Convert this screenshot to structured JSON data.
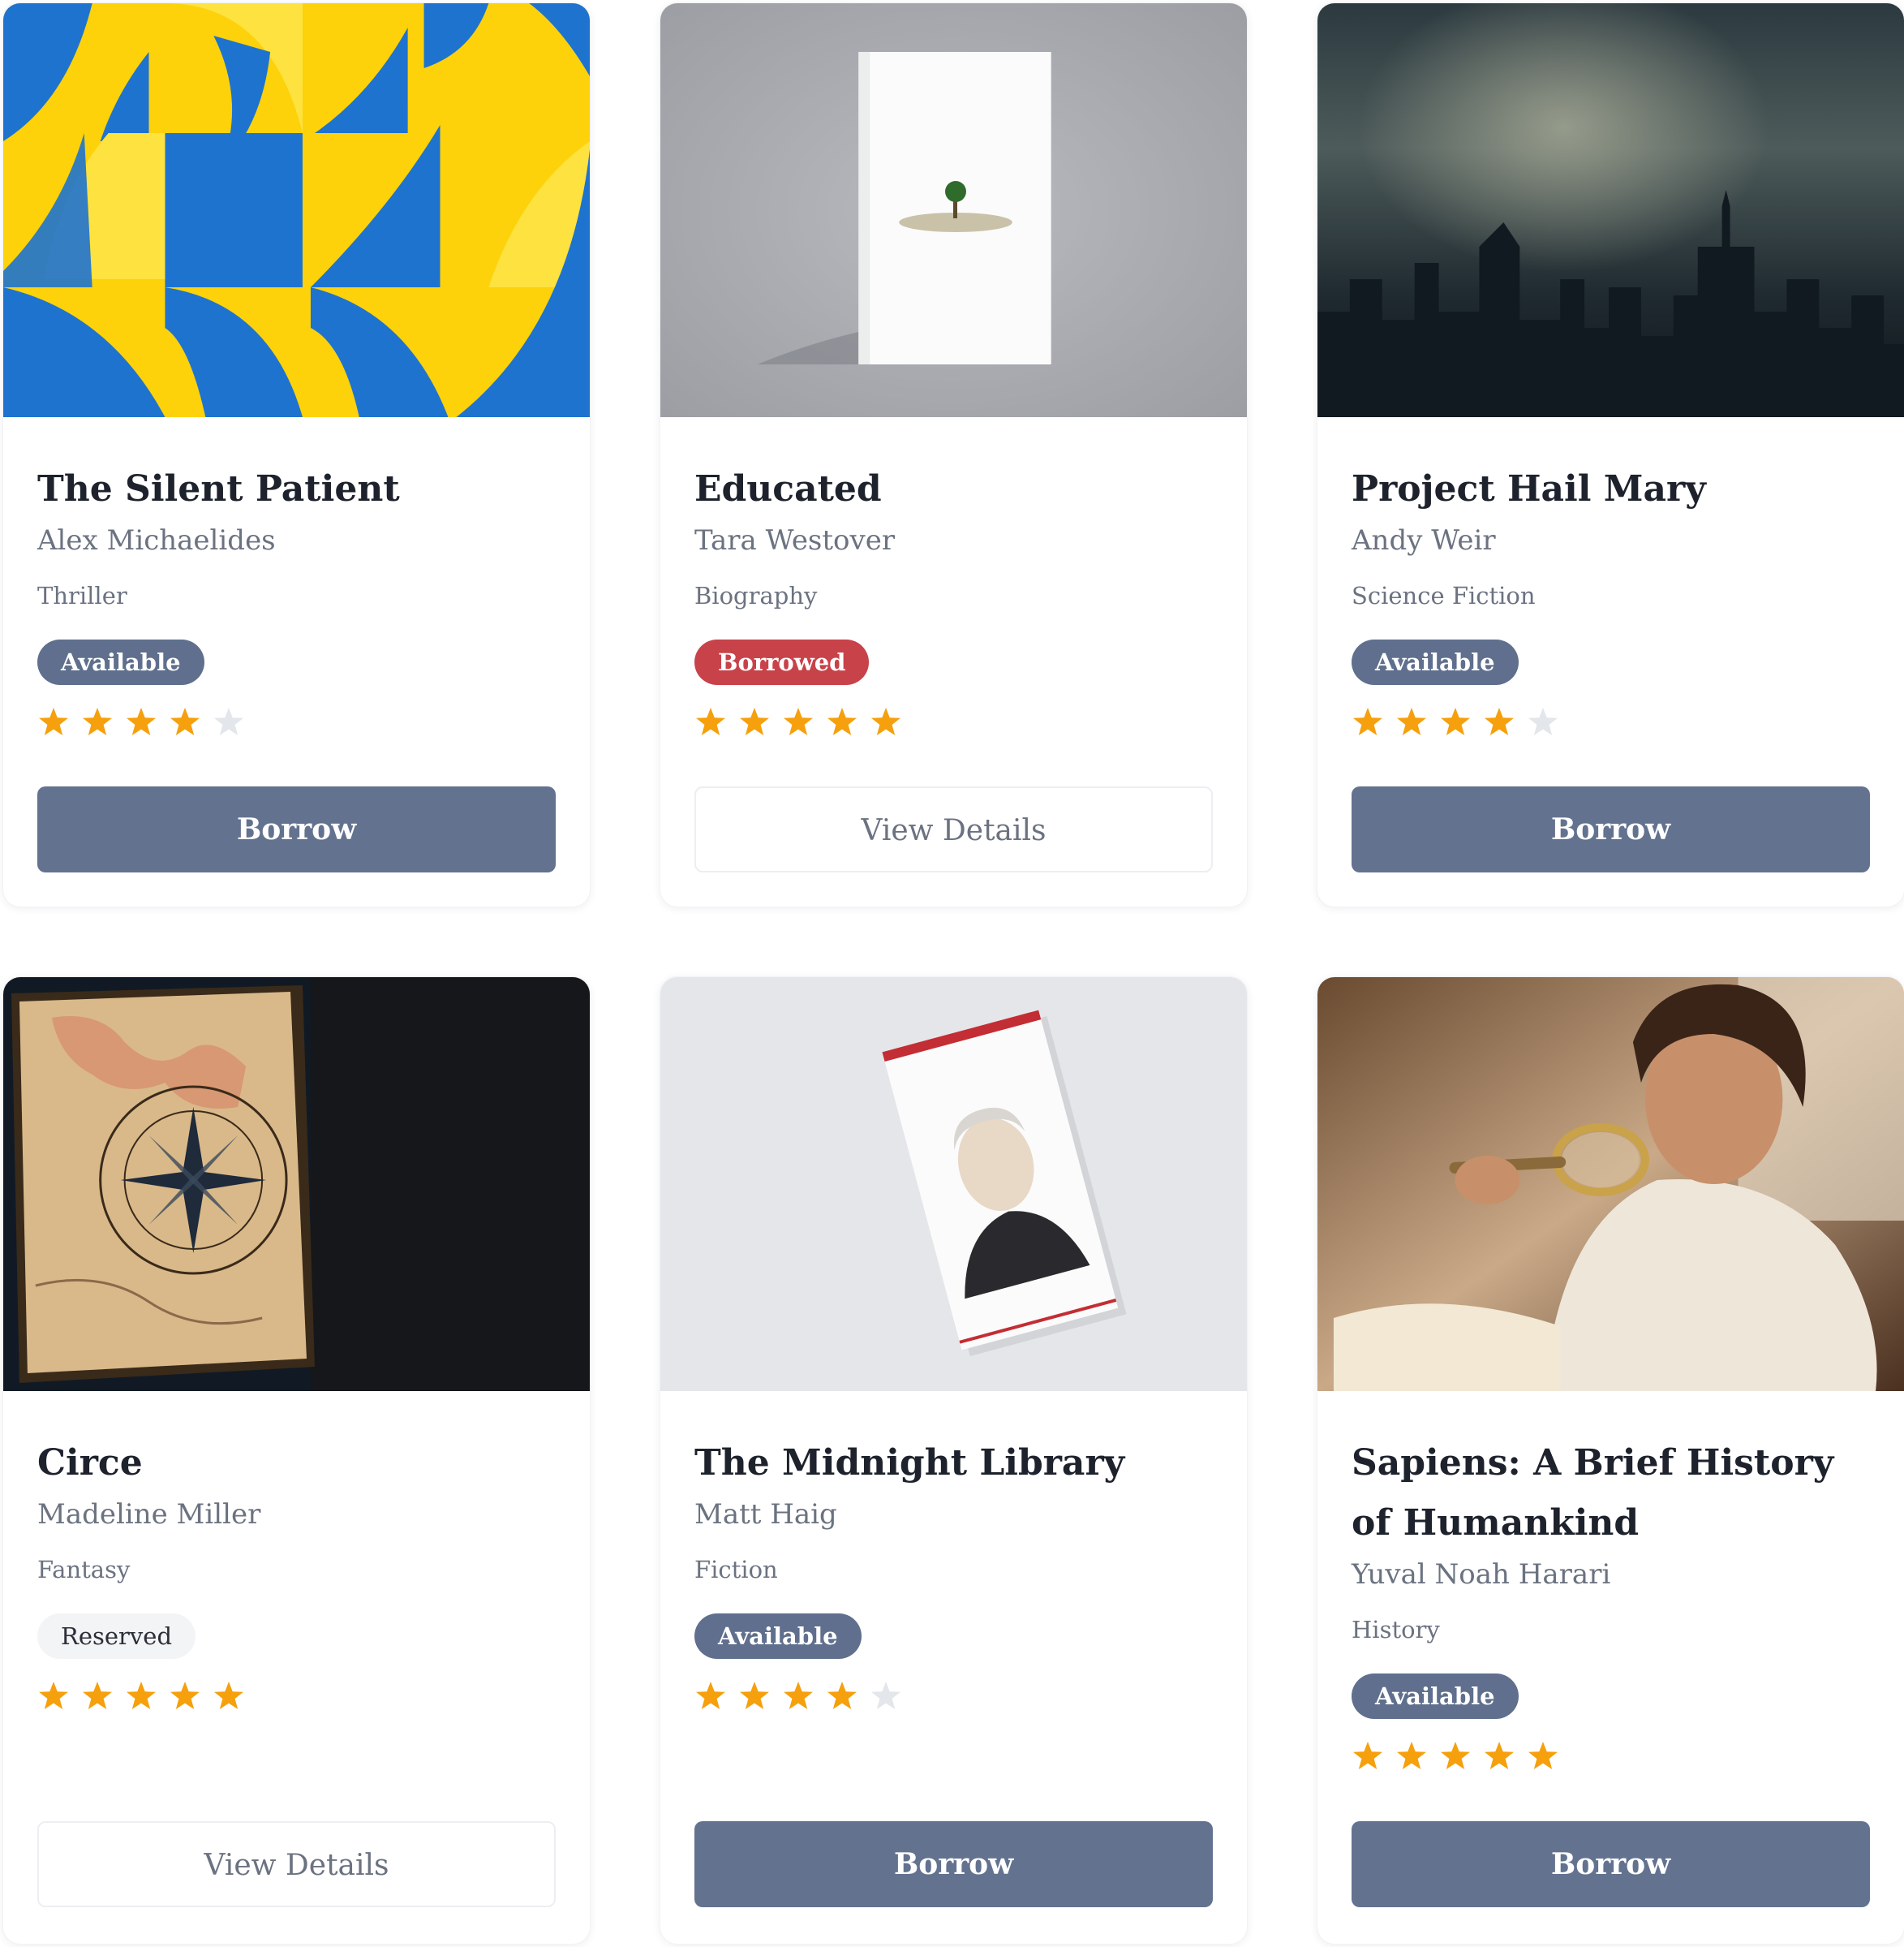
{
  "books": [
    {
      "title": "The Silent Patient",
      "author": "Alex Michaelides",
      "genre": "Thriller",
      "status": "Available",
      "rating": 4,
      "action": "Borrow",
      "cover": "abstract-blue-yellow-pattern"
    },
    {
      "title": "Educated",
      "author": "Tara Westover",
      "genre": "Biography",
      "status": "Borrowed",
      "rating": 5,
      "action": "View Details",
      "cover": "white-book-with-tree"
    },
    {
      "title": "Project Hail Mary",
      "author": "Andy Weir",
      "genre": "Science Fiction",
      "status": "Available",
      "rating": 4,
      "action": "Borrow",
      "cover": "stormy-city-skyline"
    },
    {
      "title": "Circe",
      "author": "Madeline Miller",
      "genre": "Fantasy",
      "status": "Reserved",
      "rating": 5,
      "action": "View Details",
      "cover": "old-map-compass-book"
    },
    {
      "title": "The Midnight Library",
      "author": "Matt Haig",
      "genre": "Fiction",
      "status": "Available",
      "rating": 4,
      "action": "Borrow",
      "cover": "portrait-book-on-table"
    },
    {
      "title": "Sapiens: A Brief History of Humankind",
      "author": "Yuval Noah Harari",
      "genre": "History",
      "status": "Available",
      "rating": 5,
      "action": "Borrow",
      "cover": "man-with-magnifying-glass"
    }
  ],
  "colors": {
    "primary": "#63728f",
    "available": "#5f6f8d",
    "borrowed": "#c8424a",
    "reserved_bg": "#f3f4f6",
    "star_filled": "#f5a00c",
    "star_empty": "#e3e6ea"
  }
}
